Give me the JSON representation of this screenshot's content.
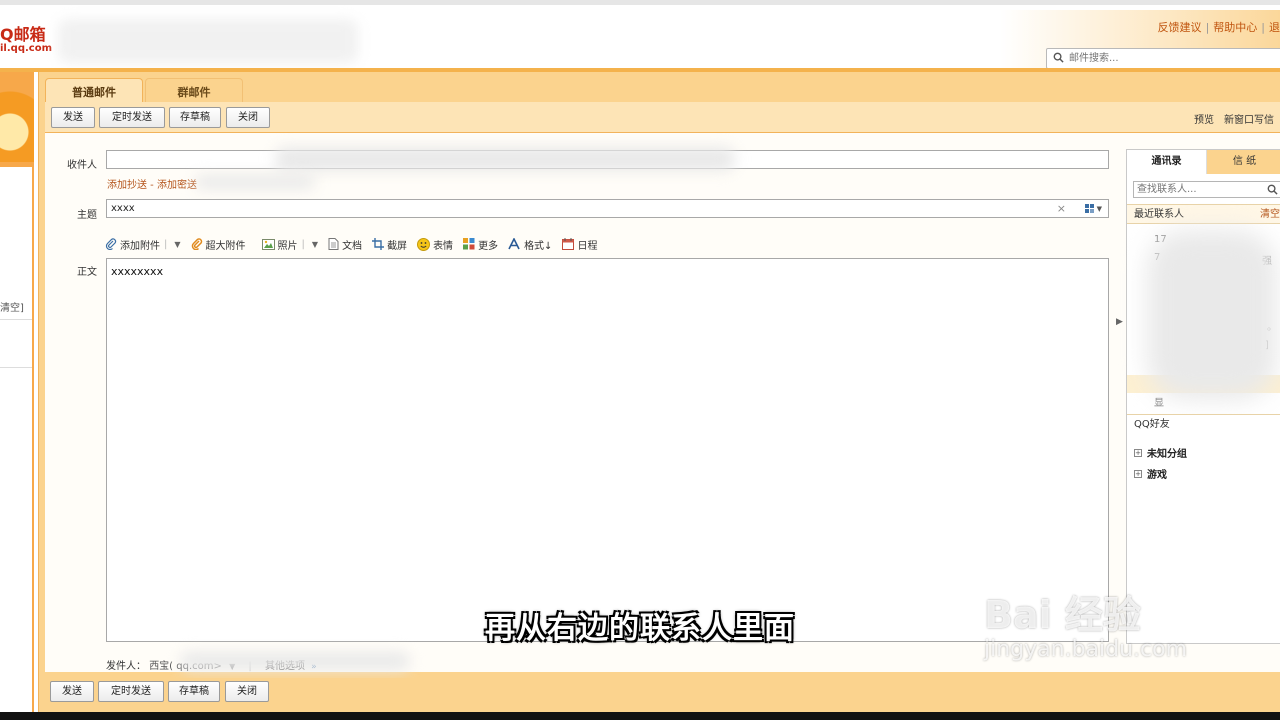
{
  "header": {
    "logo_main": "Q邮箱",
    "logo_sub": "il.qq.com",
    "links": [
      "反馈建议",
      "帮助中心",
      "退"
    ],
    "search_placeholder": "邮件搜索..."
  },
  "left_panel": {
    "clear_label": "清空]"
  },
  "compose": {
    "tabs": [
      "普通邮件",
      "群邮件"
    ],
    "toolbar": {
      "send": "发送",
      "scheduled_send": "定时发送",
      "save_draft": "存草稿",
      "close": "关闭"
    },
    "toolbar_right": [
      "预览",
      "新窗口写信"
    ],
    "recipient_label": "收件人",
    "recipient_value": "",
    "cc_links": "添加抄送 - 添加密送",
    "subject_label": "主题",
    "subject_value": "xxxx",
    "subject_clear": "×",
    "attach_items": {
      "add_attachment": "添加附件",
      "large_attachment": "超大附件",
      "photo": "照片",
      "document": "文档",
      "screenshot": "截屏",
      "emoticon": "表情",
      "more": "更多",
      "format": "格式↓",
      "schedule": "日程"
    },
    "body_label": "正文",
    "body_value": "xxxxxxxx",
    "sender_label": "发件人：",
    "sender_value": "西宝(  qq.com>",
    "other_options": "其他选项"
  },
  "contacts": {
    "tabs": [
      "通讯录",
      "信 纸"
    ],
    "search_placeholder": "查找联系人...",
    "recent_header": "最近联系人",
    "recent_clear": "清空",
    "recent_fragments": [
      "17",
      "7",
      "强",
      "。",
      "]",
      "显"
    ],
    "qq_friends_header": "QQ好友",
    "groups": [
      "未知分组",
      "游戏"
    ]
  },
  "overlay": {
    "subtitle": "再从右边的联系人里面",
    "watermark_main": "Bai 经验",
    "watermark_sub": "jingyan.baidu.com"
  },
  "colors": {
    "accent_orange": "#f4b24c",
    "panel_orange": "#fbd38e",
    "link_orange": "#b4541a",
    "logo_red": "#c82a16"
  }
}
